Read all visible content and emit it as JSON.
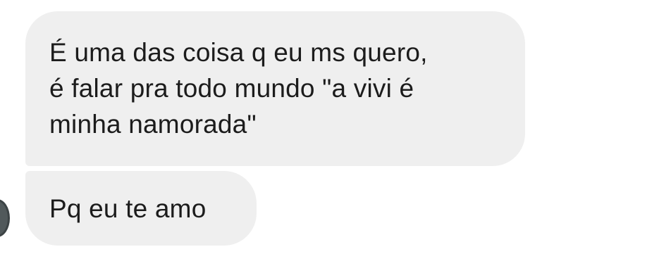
{
  "messages": [
    {
      "sender": "contact",
      "lines": [
        "É uma das coisa q eu ms quero,",
        "é falar pra todo mundo \"a vivi é",
        "minha namorada\""
      ]
    },
    {
      "sender": "contact",
      "lines": [
        "Pq eu te amo"
      ]
    }
  ],
  "colors": {
    "bubble_background": "#efefef",
    "text": "#1c1c1c",
    "avatar": "#51595b",
    "page_background": "#ffffff"
  }
}
